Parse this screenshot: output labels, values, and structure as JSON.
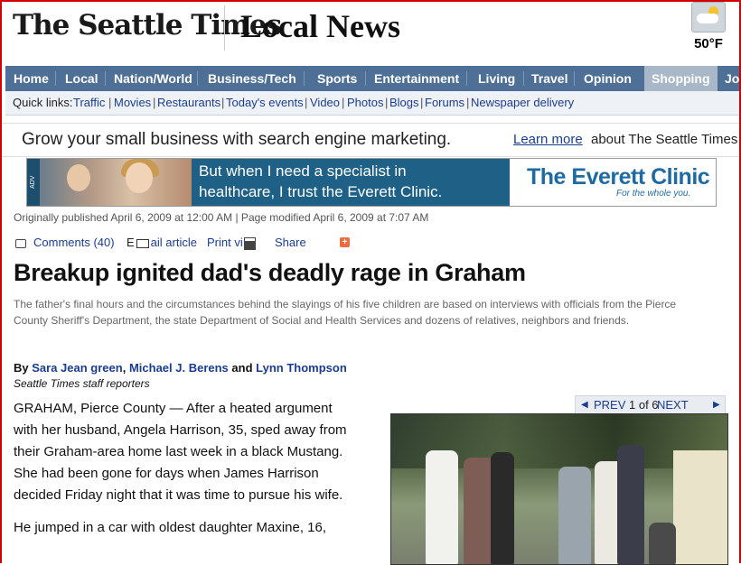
{
  "masthead": {
    "logo": "The Seattle Times",
    "section": "Local News",
    "weather": {
      "icon": "partly-cloudy-icon",
      "temp": "50°F"
    }
  },
  "nav": {
    "items": [
      "Home",
      "Local",
      "Nation/World",
      "Business/Tech",
      "Sports",
      "Entertainment",
      "Living",
      "Travel",
      "Opinion",
      "Shopping",
      "Jo"
    ],
    "active": "Shopping"
  },
  "quicklinks": {
    "label": "Quick links:",
    "links": [
      "Traffic",
      "Movies",
      "Restaurants",
      "Today's events",
      "Video",
      "Photos",
      "Blogs",
      "Forums",
      "Newspaper delivery"
    ]
  },
  "text_ad": {
    "headline": "Grow your small business with search engine marketing.",
    "link": "Learn more",
    "suffix": "about The Seattle Times"
  },
  "banner_ad": {
    "label": "ADV",
    "line1": "But when I need a specialist in",
    "line2": "healthcare, I trust the Everett Clinic.",
    "brand": "The Everett Clinic",
    "tagline": "For the whole you."
  },
  "article": {
    "meta": "Originally published April 6, 2009 at 12:00 AM | Page modified April 6, 2009 at 7:07 AM",
    "tools": {
      "comments": "Comments (40)",
      "email": "E",
      "email_rest": "ail article",
      "print": "Print vi",
      "share": "Share"
    },
    "headline": "Breakup ignited dad's deadly rage in Graham",
    "dek": "The father's final hours and the circumstances behind the slayings of his five children are based on interviews with officials from the Pierce County Sheriff's Department, the state Department of Social and Health Services and dozens of relatives, neighbors and friends.",
    "byline": {
      "prefix": "By",
      "author1": "Sara Jean green",
      "sep1": ",",
      "author2": "Michael J. Berens",
      "sep2": "and",
      "author3": "Lynn Thompson",
      "role": "Seattle Times staff reporters"
    },
    "paragraphs": [
      "GRAHAM, Pierce County — After a heated argument with her husband, Angela Harrison, 35, sped away from their Graham-area home last week in a black Mustang. She had been gone for days when James Harrison decided Friday night that it was time to pursue his wife.",
      "He jumped in a car with oldest daughter Maxine, 16,"
    ]
  },
  "gallery": {
    "prev": "PREV",
    "count": "1 of 6",
    "next": "NEXT"
  }
}
